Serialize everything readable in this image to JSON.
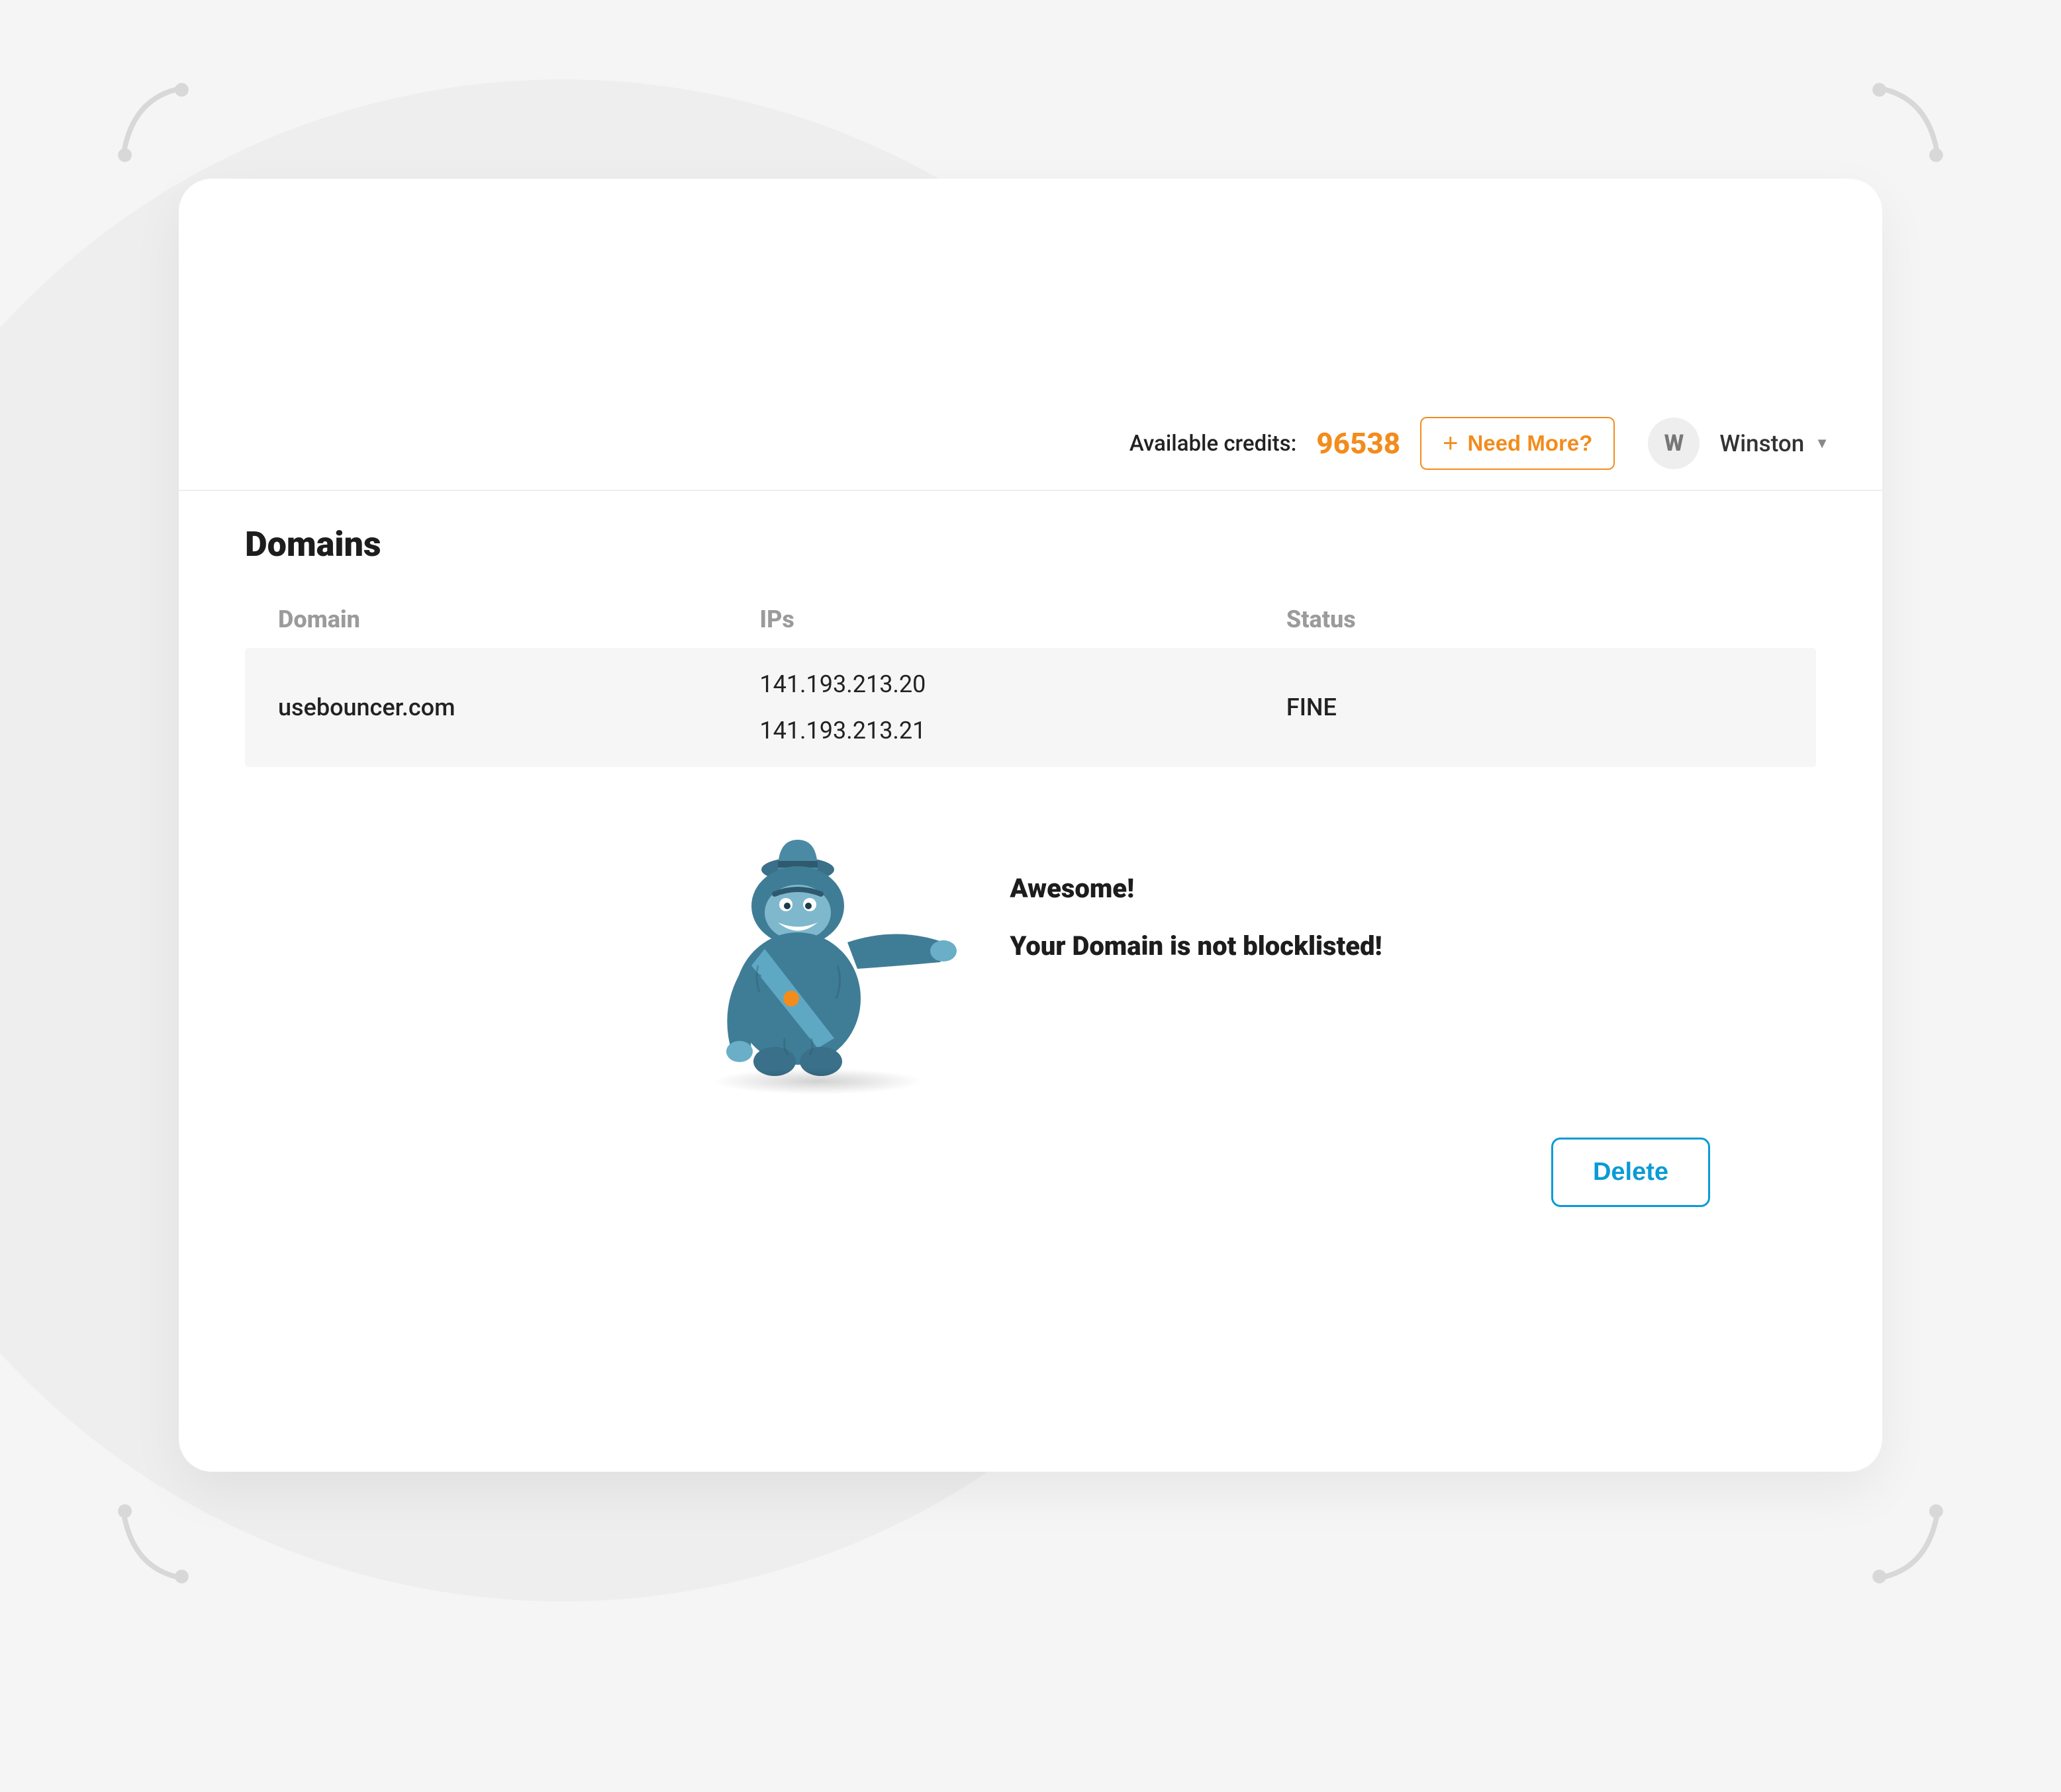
{
  "header": {
    "credits_label": "Available credits:",
    "credits_value": "96538",
    "need_more_label": "Need More?",
    "avatar_initial": "W",
    "user_name": "Winston"
  },
  "page": {
    "title": "Domains"
  },
  "table": {
    "columns": {
      "domain": "Domain",
      "ips": "IPs",
      "status": "Status"
    },
    "row": {
      "domain": "usebouncer.com",
      "ip1": "141.193.213.20",
      "ip2": "141.193.213.21",
      "status": "FINE"
    }
  },
  "result": {
    "title": "Awesome!",
    "message": "Your Domain is not blocklisted!"
  },
  "actions": {
    "delete_label": "Delete"
  },
  "colors": {
    "accent_orange": "#f28c1c",
    "accent_blue": "#0a9bd6",
    "mascot_teal": "#3f7d96"
  }
}
